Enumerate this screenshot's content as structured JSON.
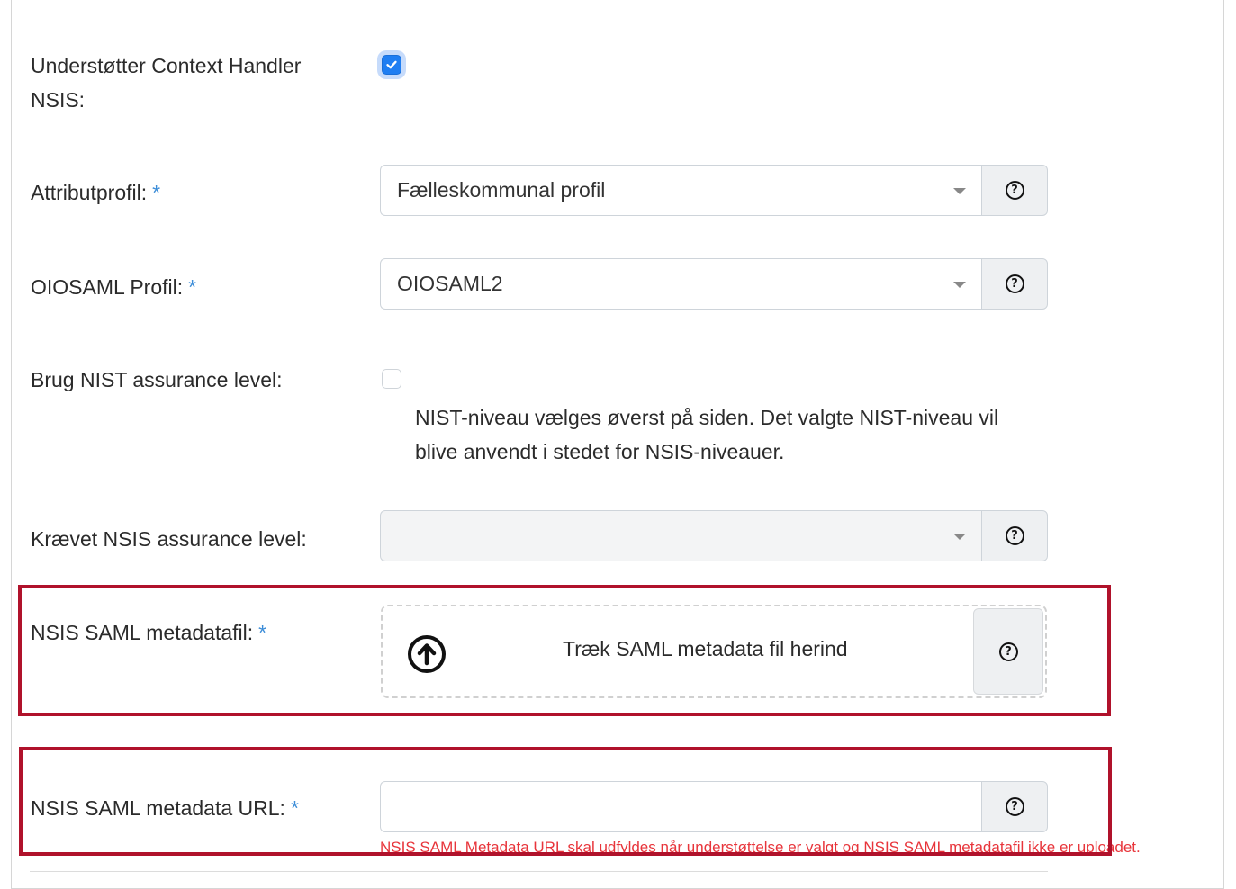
{
  "form": {
    "context_handler": {
      "label_line1": "Understøtter Context Handler",
      "label_line2": "NSIS:",
      "checked": true
    },
    "attribute_profile": {
      "label": "Attributprofil:",
      "required_mark": "*",
      "selected": "Fælleskommunal profil",
      "help_icon": "question-circle-icon"
    },
    "oiosaml_profile": {
      "label": "OIOSAML Profil:",
      "required_mark": "*",
      "selected": "OIOSAML2",
      "help_icon": "question-circle-icon"
    },
    "nist": {
      "label": "Brug NIST assurance level:",
      "checked": false,
      "description_line1": "NIST-niveau vælges øverst på siden. Det valgte NIST-niveau vil",
      "description_line2": "blive anvendt i stedet for NSIS-niveauer."
    },
    "nsis_level": {
      "label": "Krævet NSIS assurance level:",
      "selected": "",
      "help_icon": "question-circle-icon"
    },
    "metadata_file": {
      "label": "NSIS SAML metadatafil:",
      "required_mark": "*",
      "dropzone_text": "Træk SAML metadata fil herind",
      "upload_icon": "upload-circle-icon",
      "help_icon": "question-circle-icon"
    },
    "metadata_url": {
      "label": "NSIS SAML metadata URL:",
      "required_mark": "*",
      "value": "",
      "error": "NSIS SAML Metadata URL skal udfyldes når understøttelse er valgt og NSIS SAML metadatafil ikke er uploadet.",
      "help_icon": "question-circle-icon"
    }
  },
  "colors": {
    "required": "#3c8dd8",
    "checkbox_checked": "#1f7ef2",
    "error": "#e8353b",
    "highlight_border": "#b0122b"
  }
}
